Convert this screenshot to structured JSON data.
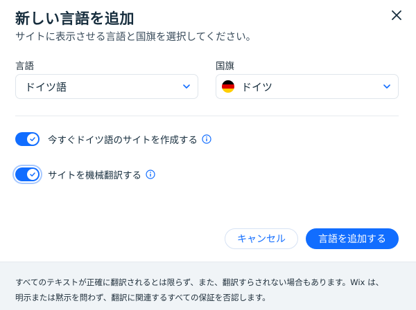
{
  "dialog": {
    "title": "新しい言語を追加",
    "subtitle": "サイトに表示させる言語と国旗を選択してください。"
  },
  "language_field": {
    "label": "言語",
    "value": "ドイツ語"
  },
  "flag_field": {
    "label": "国旗",
    "value": "ドイツ",
    "flag_colors": [
      "#000000",
      "#dd0000",
      "#ffce00"
    ]
  },
  "toggles": [
    {
      "label": "今すぐドイツ語のサイトを作成する",
      "on": true
    },
    {
      "label": "サイトを機械翻訳する",
      "on": true
    }
  ],
  "buttons": {
    "cancel": "キャンセル",
    "add": "言語を追加する"
  },
  "footer": {
    "line1": "すべてのテキストが正確に翻訳されるとは限らず、また、翻訳すらされない場合もあります。Wix は、",
    "line2": "明示または黙示を問わず、翻訳に関連するすべての保証を否認します。"
  },
  "colors": {
    "accent": "#116dff",
    "text": "#162d3d",
    "footer_bg": "#f0f4f7"
  }
}
